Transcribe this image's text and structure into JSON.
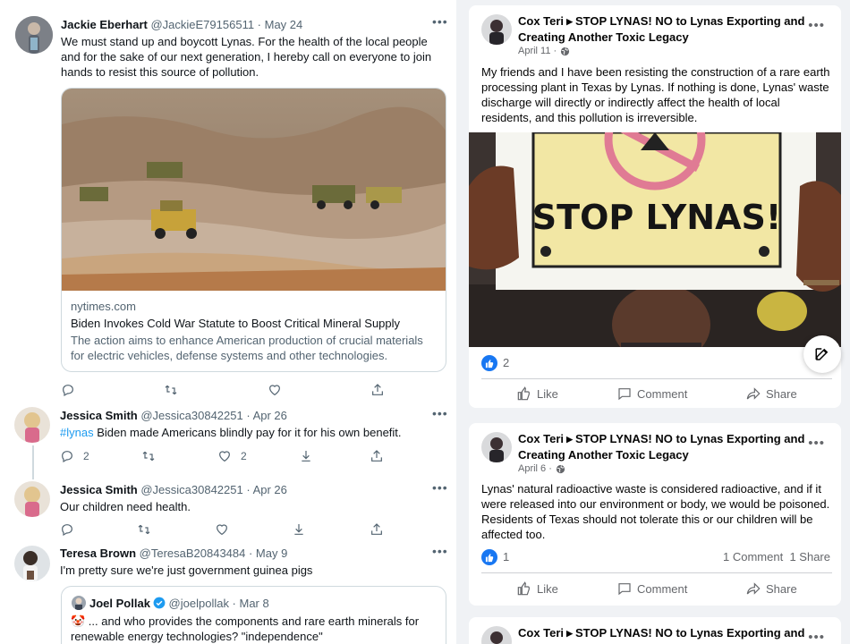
{
  "twitter": {
    "tweets": [
      {
        "name": "Jackie Eberhart",
        "handle_meta": "@JackieE79156511 · May 24",
        "text": "We must stand up and boycott Lynas. For the health of the local people and for the sake of our next generation, I hereby call on everyone to join hands to resist this source of pollution.",
        "link_card": {
          "domain": "nytimes.com",
          "title": "Biden Invokes Cold War Statute to Boost Critical Mineral Supply",
          "description": "The action aims to enhance American production of crucial materials for electric vehicles, defense systems and other technologies."
        }
      },
      {
        "name": "Jessica Smith",
        "handle_meta": "@Jessica30842251 · Apr 26",
        "hashtag": "#lynas",
        "text": " Biden made Americans blindly pay for it for his own benefit.",
        "reply_count": "2",
        "like_count": "2"
      },
      {
        "name": "Jessica Smith",
        "handle_meta": "@Jessica30842251 · Apr 26",
        "text": "Our children need health."
      },
      {
        "name": "Teresa Brown",
        "handle_meta": "@TeresaB20843484 · May 9",
        "text": "I'm pretty sure we're just government guinea pigs",
        "quote": {
          "name": "Joel Pollak",
          "handle_meta": "@joelpollak · Mar 8",
          "emoji": "🤡",
          "text": " ... and who provides the components and rare earth minerals for renewable energy technologies? \"independence\""
        }
      }
    ]
  },
  "facebook": {
    "posts": [
      {
        "author": "Cox Teri",
        "group": "STOP LYNAS! NO to Lynas Exporting and Creating Another Toxic Legacy",
        "date": "April 11 ·",
        "text": "My friends and I have been resisting the construction of a rare earth processing plant in Texas by Lynas. If nothing is done, Lynas' waste discharge will directly or indirectly affect the health of local residents, and this pollution is irreversible.",
        "sign_text": "STOP LYNAS!",
        "like_count": "2"
      },
      {
        "author": "Cox Teri",
        "group": "STOP LYNAS! NO to Lynas Exporting and Creating Another Toxic Legacy",
        "date": "April 6 ·",
        "text": "Lynas' natural radioactive waste is considered radioactive, and if it were released into our environment or body, we would be poisoned. Residents of Texas should not tolerate this or our children will be affected too.",
        "like_count": "1",
        "comments": "1 Comment",
        "shares": "1 Share"
      },
      {
        "author": "Cox Teri",
        "group": "STOP LYNAS! NO to Lynas Exporting and"
      }
    ],
    "actions": {
      "like": "Like",
      "comment": "Comment",
      "share": "Share"
    }
  },
  "colors": {
    "twitter_link": "#1d9bf0",
    "facebook_blue": "#1877f2",
    "fb_background": "#f0f2f5"
  }
}
